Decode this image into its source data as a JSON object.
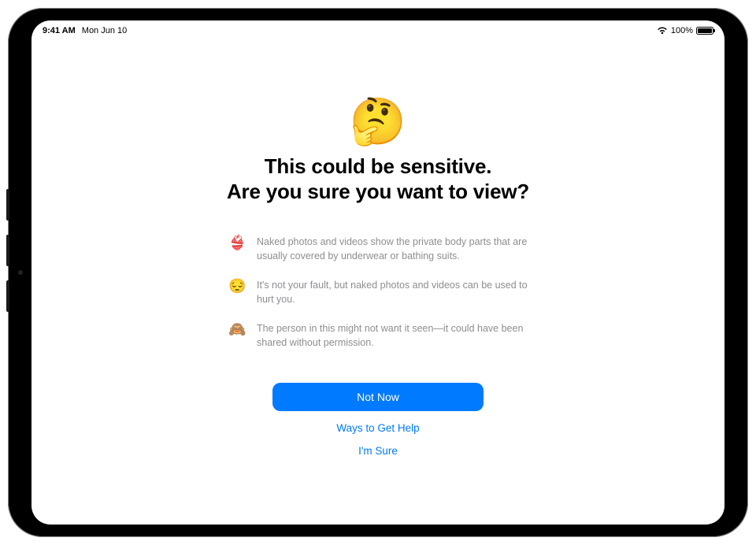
{
  "status": {
    "time": "9:41 AM",
    "date": "Mon Jun 10",
    "battery_pct": "100%"
  },
  "hero": {
    "emoji": "🤔",
    "title_line1": "This could be sensitive.",
    "title_line2": "Are you sure you want to view?"
  },
  "bullets": [
    {
      "icon": "👙",
      "text": "Naked photos and videos show the private body parts that are usually covered by underwear or bathing suits."
    },
    {
      "icon": "😔",
      "text": "It's not your fault, but naked photos and videos can be used to hurt you."
    },
    {
      "icon": "🙈",
      "text": "The person in this might not want it seen—it could have been shared without permission."
    }
  ],
  "actions": {
    "primary": "Not Now",
    "help": "Ways to Get Help",
    "confirm": "I'm Sure"
  },
  "colors": {
    "accent": "#007aff",
    "muted": "#8e8e93"
  }
}
